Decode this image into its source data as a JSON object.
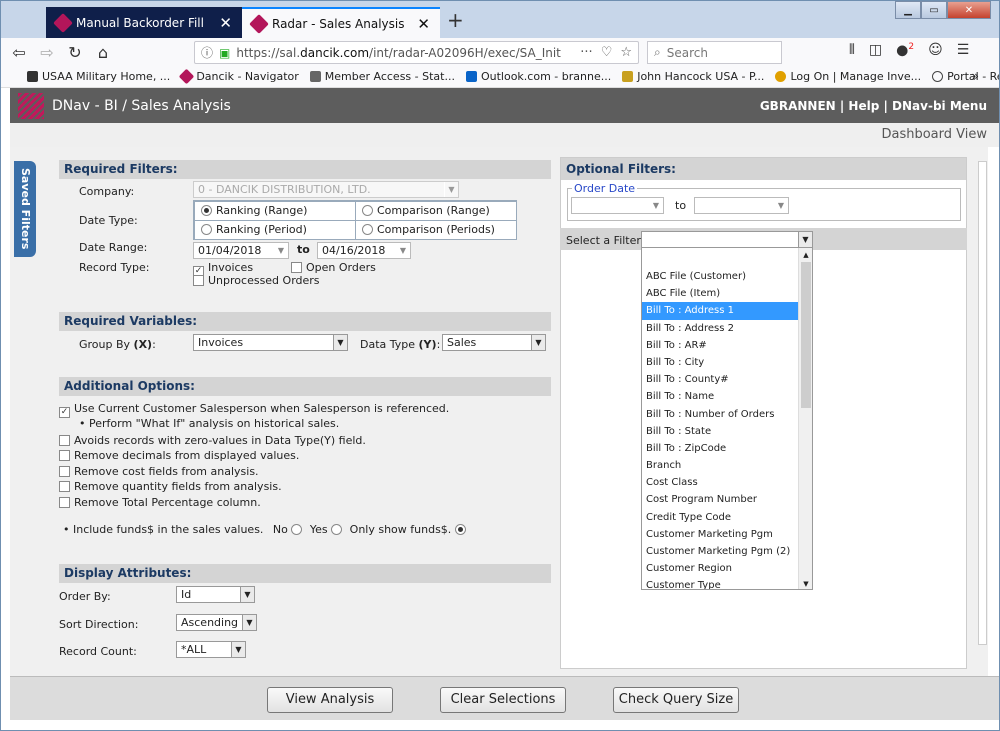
{
  "browser": {
    "tabs": [
      {
        "label": "Manual Backorder Fill",
        "active": false
      },
      {
        "label": "Radar - Sales Analysis",
        "active": true
      }
    ],
    "url_prefix": "https://sal.",
    "url_domain": "dancik.com",
    "url_path": "/int/radar-A02096H/exec/SA_Init",
    "search_placeholder": "Search",
    "url_more": "···",
    "notif_count": "2",
    "bookmarks": [
      {
        "label": "USAA Military Home, ...",
        "icon": "eagle-icon",
        "color": "#333333"
      },
      {
        "label": "Dancik - Navigator",
        "icon": "dancik-icon",
        "color": "#b3165a"
      },
      {
        "label": "Member Access - Stat...",
        "icon": "member-icon",
        "color": "#666666"
      },
      {
        "label": "Outlook.com - branne...",
        "icon": "outlook-icon",
        "color": "#0a64c8"
      },
      {
        "label": "John Hancock USA - P...",
        "icon": "hancock-icon",
        "color": "#c8a020"
      },
      {
        "label": "Log On | Manage Inve...",
        "icon": "star-icon",
        "color": "#e0a000"
      },
      {
        "label": "Portal - Retirement",
        "icon": "globe-icon",
        "color": "#444444"
      }
    ],
    "bookmarks_more": "»"
  },
  "app": {
    "title": "DNav - BI / Sales Analysis",
    "user_links": "GBRANNEN | Help | DNav-bi Menu",
    "dashboard_view": "Dashboard View",
    "saved_filters": "Saved Filters"
  },
  "required_filters": {
    "header": "Required Filters:",
    "company_label": "Company:",
    "company_value": "0 - DANCIK DISTRIBUTION, LTD.",
    "date_type_label": "Date Type:",
    "date_types": [
      {
        "label": "Ranking (Range)",
        "checked": true
      },
      {
        "label": "Comparison (Range)",
        "checked": false
      },
      {
        "label": "Ranking (Period)",
        "checked": false
      },
      {
        "label": "Comparison (Periods)",
        "checked": false
      }
    ],
    "date_range_label": "Date Range:",
    "date_from": "01/04/2018",
    "date_to_label": "to",
    "date_to": "04/16/2018",
    "record_type_label": "Record Type:",
    "record_types": [
      {
        "label": "Invoices",
        "checked": true
      },
      {
        "label": "Open Orders",
        "checked": false
      },
      {
        "label": "Unprocessed Orders",
        "checked": false
      }
    ]
  },
  "required_variables": {
    "header": "Required Variables:",
    "group_by_label": "Group By",
    "group_by_key": "(X)",
    "group_by_value": "Invoices",
    "data_type_label": "Data Type",
    "data_type_key": "(Y)",
    "data_type_value": "Sales"
  },
  "additional_options": {
    "header": "Additional Options:",
    "options": [
      {
        "label": "Use Current Customer Salesperson when Salesperson is referenced.",
        "checked": true
      },
      {
        "label": "Avoids records with zero-values in Data Type(Y) field.",
        "checked": false
      },
      {
        "label": "Remove decimals from displayed values.",
        "checked": false
      },
      {
        "label": "Remove cost fields from analysis.",
        "checked": false
      },
      {
        "label": "Remove quantity fields from analysis.",
        "checked": false
      },
      {
        "label": "Remove Total Percentage column.",
        "checked": false
      }
    ],
    "what_if_note": "• Perform \"What If\" analysis on historical sales.",
    "funds_prompt": "• Include funds$ in the sales values.",
    "funds_options": [
      {
        "label": "No",
        "checked": false
      },
      {
        "label": "Yes",
        "checked": false
      },
      {
        "label": "Only show funds$.",
        "checked": true
      }
    ]
  },
  "display_attributes": {
    "header": "Display Attributes:",
    "order_by_label": "Order By:",
    "order_by_value": "Id",
    "sort_direction_label": "Sort Direction:",
    "sort_direction_value": "Ascending",
    "record_count_label": "Record Count:",
    "record_count_value": "*ALL"
  },
  "optional_filters": {
    "header": "Optional Filters:",
    "order_date_legend": "Order Date",
    "to_label": "to",
    "select_filter_label": "Select a Filter:",
    "select_filter_value": "",
    "filter_options": [
      "ABC File (Customer)",
      "ABC File (Item)",
      "Bill To : Address 1",
      "Bill To : Address 2",
      "Bill To : AR#",
      "Bill To : City",
      "Bill To : County#",
      "Bill To : Name",
      "Bill To : Number of Orders",
      "Bill To : State",
      "Bill To : ZipCode",
      "Branch",
      "Cost Class",
      "Cost Program Number",
      "Credit Type Code",
      "Customer Marketing Pgm",
      "Customer Marketing Pgm (2)",
      "Customer Region",
      "Customer Type"
    ],
    "selected_option": "Bill To : Address 1"
  },
  "footer": {
    "view_analysis": "View Analysis",
    "clear_selections": "Clear Selections",
    "check_query_size": "Check Query Size"
  }
}
